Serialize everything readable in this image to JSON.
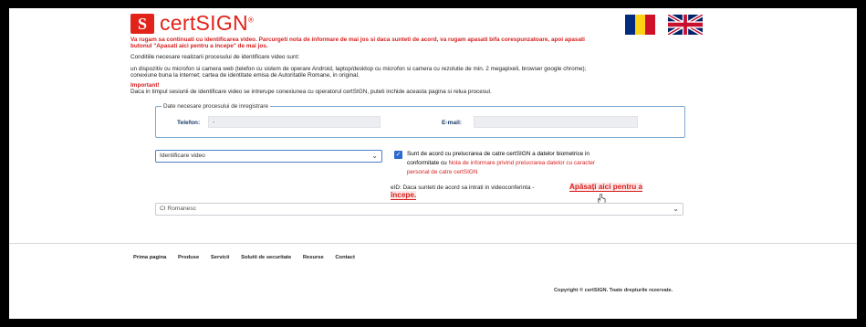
{
  "brand": {
    "name": "certSIGN",
    "mark": "S",
    "reg": "®"
  },
  "languages": [
    "ro",
    "en"
  ],
  "intro": {
    "line1": "Va rugam sa continuati cu identificarea video. Parcurgeti nota de informare de mai jos si daca sunteti de acord, va rugam apasati bifa corespunzatoare, apoi apasati",
    "line2": "butonul \"Apasati aici pentru a incepe\" de mai jos."
  },
  "conditions": {
    "heading": "Conditiile necesare realizarii procesului de identificare video sunt:",
    "line1": "un dispozitiv cu microfon si camera web (telefon cu sistem de  operare Android, laptop/desktop cu microfon si camera cu rezolutie de min. 2 megapixeli, browser google chrome);",
    "line2": "conexiune buna la internet; cartea de identitate emisa de Autoritatile Romane, in original."
  },
  "important": {
    "title": "Important!",
    "text": "Daca in timpul sesiunii de identificare video se intrerupe conexiunea cu operatorul certSIGN, puteti inchide aceasta pagina si relua procesul."
  },
  "form": {
    "legend": "Date necesare procesului de inregistrare",
    "phone_label": "Telefon:",
    "phone_value": "-",
    "email_label": "E-mail:",
    "email_value": ""
  },
  "method_select": {
    "value": "Identificare video"
  },
  "consent": {
    "line1": "Sunt de acord cu prelucrarea de catre certSIGN a datelor biometrice in",
    "line2_prefix": "conformitate cu ",
    "line2_link": "Nota de informare privind prelucrarea datelor cu caracter",
    "line3_link": "personal de catre certSIGN",
    "checked": true
  },
  "eid": {
    "text": "eID: Daca sunteti de acord sa intrati in videoconferinta - ",
    "cta_part1": "Apăsați aici pentru a",
    "cta_part2": "începe."
  },
  "id_select": {
    "value": "CI Romanesc"
  },
  "footer": {
    "nav": [
      "Prima pagina",
      "Produse",
      "Servicii",
      "Solutii de securitate",
      "Resurse",
      "Contact"
    ],
    "copyright": "Copyright © certSIGN. Toate drepturile rezervate."
  },
  "colors": {
    "brand_red": "#e2231a",
    "link_red": "#d62020",
    "check_blue": "#2f6ad0",
    "flag_blue": "#002b7f",
    "flag_yellow": "#fcd116",
    "flag_red": "#ce1126"
  },
  "icons": {
    "chevron": "chevron-down-icon",
    "check": "check-icon",
    "cursor": "hand-cursor-icon"
  }
}
